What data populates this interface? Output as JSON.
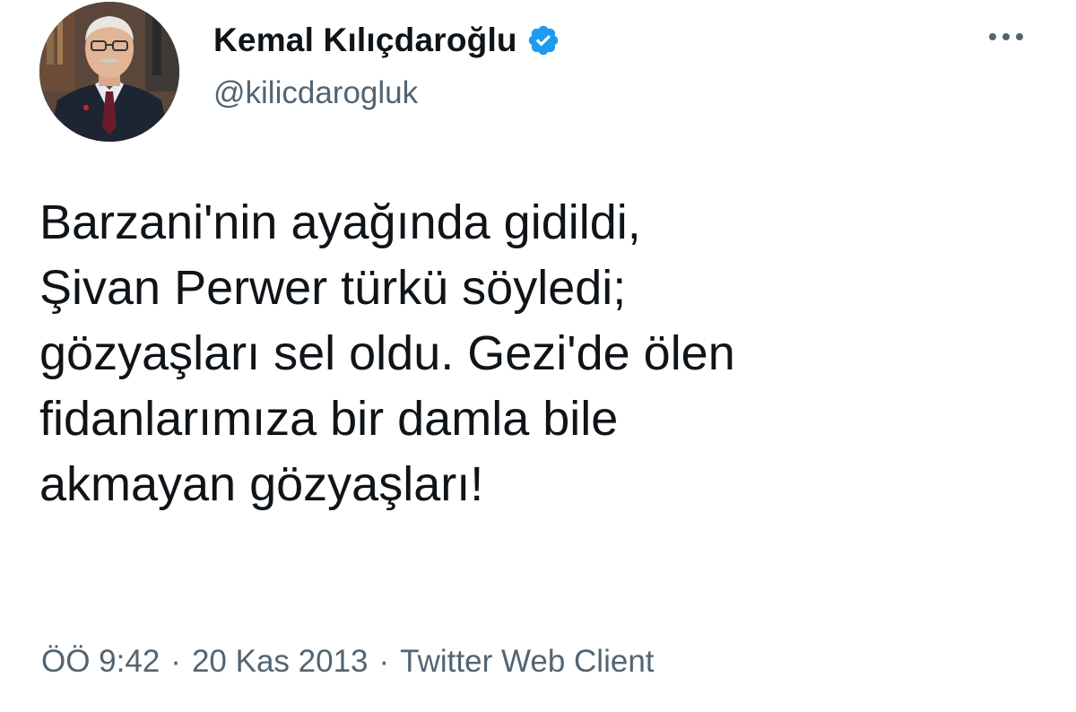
{
  "author": {
    "display_name": "Kemal Kılıçdaroğlu",
    "handle": "@kilicdarogluk",
    "verified_icon": "verified-badge-icon",
    "avatar_icon": "profile-photo"
  },
  "tweet": {
    "lines": [
      "Barzani'nin ayağında gidildi,",
      "Şivan Perwer türkü söyledi;",
      "gözyaşları sel oldu. Gezi'de ölen",
      "fidanlarımıza bir damla bile",
      "akmayan gözyaşları!"
    ]
  },
  "meta": {
    "time": "ÖÖ 9:42",
    "separator": "·",
    "date": "20 Kas 2013",
    "source": "Twitter Web Client"
  },
  "colors": {
    "text": "#0f1419",
    "secondary": "#536471",
    "verified": "#1d9bf0"
  }
}
